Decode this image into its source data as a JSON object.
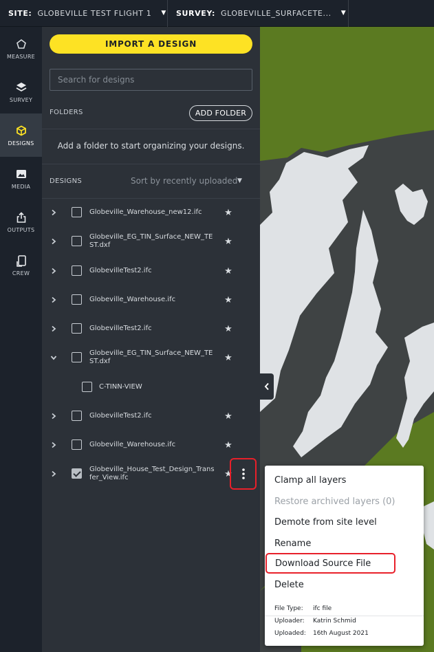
{
  "topbar": {
    "site_key": "SITE:",
    "site_value": "GLOBEVILLE TEST FLIGHT 1",
    "survey_key": "SURVEY:",
    "survey_value": "GLOBEVILLE_SURFACETE..."
  },
  "rail": {
    "measure": "MEASURE",
    "survey": "SURVEY",
    "designs": "DESIGNS",
    "media": "MEDIA",
    "outputs": "OUTPUTS",
    "crew": "CREW",
    "active": "designs"
  },
  "panel": {
    "import_label": "IMPORT A DESIGN",
    "search_placeholder": "Search for designs",
    "folders_label": "FOLDERS",
    "add_folder_label": "ADD FOLDER",
    "folder_hint": "Add a folder to start organizing your designs.",
    "designs_label": "DESIGNS",
    "sort_label": "Sort by recently uploaded"
  },
  "designs": [
    {
      "name": "Globeville_Warehouse_new12.ifc"
    },
    {
      "name": "Globeville_EG_TIN_Surface_NEW_TEST.dxf"
    },
    {
      "name": "GlobevilleTest2.ifc"
    },
    {
      "name": "Globeville_Warehouse.ifc"
    },
    {
      "name": "GlobevilleTest2.ifc"
    },
    {
      "name": "Globeville_EG_TIN_Surface_NEW_TEST.dxf",
      "expanded": true
    },
    {
      "name": "C-TINN-VIEW",
      "child": true
    },
    {
      "name": "GlobevilleTest2.ifc"
    },
    {
      "name": "Globeville_Warehouse.ifc"
    },
    {
      "name": "Globeville_House_Test_Design_Transfer_View.ifc",
      "checked": true
    }
  ],
  "menu": {
    "clamp": "Clamp all layers",
    "restore": "Restore archived layers (0)",
    "demote": "Demote from site level",
    "rename": "Rename",
    "download": "Download Source File",
    "delete": "Delete",
    "file_type_key": "File Type:",
    "file_type_value": "ifc file",
    "uploader_key": "Uploader:",
    "uploader_value": "Katrin Schmid",
    "uploaded_key": "Uploaded:",
    "uploaded_value": "16th August 2021"
  },
  "colors": {
    "accent_yellow": "#fde224",
    "highlight_red": "#e8202a",
    "map_green": "#5b7a21",
    "map_dark": "#3f4344",
    "map_white": "#dfe2e5"
  }
}
